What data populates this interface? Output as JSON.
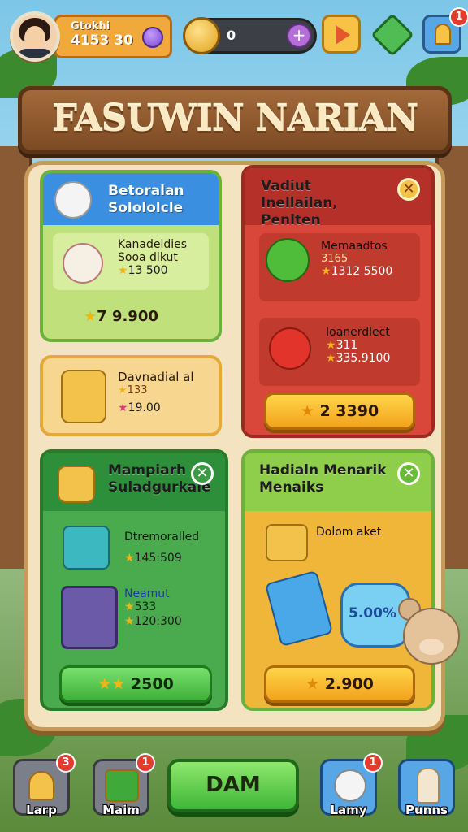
{
  "player": {
    "name": "Gtokhi",
    "score": "4153 30"
  },
  "currency": {
    "coins": "0"
  },
  "top_buttons": {
    "play": "play-icon",
    "gift": "gift-icon",
    "bell": "bell-icon",
    "bell_badge": "1"
  },
  "title": "FASUWIN NARIAN",
  "cards": {
    "c1": {
      "title": "Betoralan Solololcle",
      "item_name": "Kanadeldies",
      "item_sub": "Sooa dlkut",
      "item_price": "13 500",
      "footer": "7 9.900"
    },
    "c2": {
      "name": "Davnadial al",
      "sub": "133",
      "price": "19.00"
    },
    "c3": {
      "title": "Vadiut Inellailan, Penlten",
      "item1_name": "Memaadtos",
      "item1_sub": "3165",
      "item1_price": "1312 5500",
      "item2_name": "Ioanerdlect",
      "item2_sub": "311",
      "item2_price": "335.9100",
      "button": "2  3390"
    },
    "c4": {
      "title": "Mampiarh Suladgurkale",
      "item1_name": "Dtremoralled",
      "item1_price": "145:509",
      "item2_name": "Neamut",
      "item2_sub": "533",
      "item2_price": "120:300",
      "button": "2500"
    },
    "c5": {
      "title": "Hadialn Menarik Menaiks",
      "item1_name": "Dolom aket",
      "bottle_label": "5.00%",
      "button": "2.900"
    }
  },
  "bottom": {
    "left1": {
      "label": "Larp",
      "badge": "3"
    },
    "left2": {
      "label": "Maim",
      "badge": "1"
    },
    "main": "DAM",
    "right1": {
      "label": "Lamy",
      "badge": "1"
    },
    "right2": {
      "label": "Punns"
    }
  },
  "colors": {
    "accent": "#f2a93b",
    "wood": "#7b4a24",
    "red": "#d9473a",
    "green": "#4aab4e"
  }
}
